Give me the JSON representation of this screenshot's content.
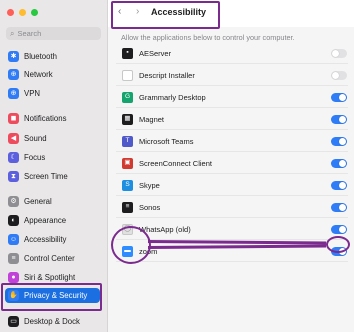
{
  "window": {
    "title": "Accessibility"
  },
  "sidebar": {
    "search_placeholder": "Search",
    "items": [
      {
        "label": "Bluetooth",
        "icon": "bluetooth-icon",
        "color": "#2f7cf6",
        "glyph": "✱"
      },
      {
        "label": "Network",
        "icon": "globe-icon",
        "color": "#2f7cf6",
        "glyph": "⊕"
      },
      {
        "label": "VPN",
        "icon": "globe-icon",
        "color": "#2f7cf6",
        "glyph": "⊕"
      },
      {
        "label": "Notifications",
        "icon": "bell-icon",
        "color": "#ee4b5d",
        "glyph": "◼"
      },
      {
        "label": "Sound",
        "icon": "speaker-icon",
        "color": "#ee4b5d",
        "glyph": "◀"
      },
      {
        "label": "Focus",
        "icon": "moon-icon",
        "color": "#5c5fde",
        "glyph": "☾"
      },
      {
        "label": "Screen Time",
        "icon": "hourglass-icon",
        "color": "#5c5fde",
        "glyph": "⧗"
      },
      {
        "label": "General",
        "icon": "gear-icon",
        "color": "#8e8e93",
        "glyph": "⚙"
      },
      {
        "label": "Appearance",
        "icon": "appearance-icon",
        "color": "#1d1d1f",
        "glyph": "◐"
      },
      {
        "label": "Accessibility",
        "icon": "accessibility-icon",
        "color": "#2f7cf6",
        "glyph": "☺"
      },
      {
        "label": "Control Center",
        "icon": "control-center-icon",
        "color": "#8e8e93",
        "glyph": "≡"
      },
      {
        "label": "Siri & Spotlight",
        "icon": "siri-icon",
        "color": "#c042d8",
        "glyph": "●"
      },
      {
        "label": "Privacy & Security",
        "icon": "hand-icon",
        "color": "#2f7cf6",
        "glyph": "✋",
        "selected": true
      },
      {
        "label": "Desktop & Dock",
        "icon": "desktop-icon",
        "color": "#1d1d1f",
        "glyph": "▭"
      }
    ]
  },
  "main": {
    "description": "Allow the applications below to control your computer.",
    "apps": [
      {
        "label": "AEServer",
        "icon": "terminal-icon",
        "color": "#1d1d1f",
        "glyph": "▪",
        "enabled": false
      },
      {
        "label": "Descript Installer",
        "icon": "generic-app-icon",
        "color": "#ffffff",
        "glyph": "",
        "enabled": false
      },
      {
        "label": "Grammarly Desktop",
        "icon": "grammarly-icon",
        "color": "#15a36e",
        "glyph": "G",
        "enabled": true
      },
      {
        "label": "Magnet",
        "icon": "magnet-icon",
        "color": "#1d1d1f",
        "glyph": "▦",
        "enabled": true
      },
      {
        "label": "Microsoft Teams",
        "icon": "teams-icon",
        "color": "#5059c9",
        "glyph": "T",
        "enabled": true
      },
      {
        "label": "ScreenConnect Client",
        "icon": "screenconnect-icon",
        "color": "#d13a2f",
        "glyph": "▣",
        "enabled": true
      },
      {
        "label": "Skype",
        "icon": "skype-icon",
        "color": "#1e8fe0",
        "glyph": "S",
        "enabled": true
      },
      {
        "label": "Sonos",
        "icon": "sonos-icon",
        "color": "#1d1d1f",
        "glyph": "≡",
        "enabled": true
      },
      {
        "label": "WhatsApp (old)",
        "icon": "whatsapp-icon",
        "color": "#e0e0e0",
        "glyph": "◯",
        "enabled": true
      },
      {
        "label": "zoom",
        "icon": "zoom-icon",
        "color": "#2d8cff",
        "glyph": "▬",
        "enabled": true
      }
    ]
  },
  "colors": {
    "accent": "#2e7cf6",
    "highlight": "#7b2a8e",
    "selected": "#1c6fe0"
  }
}
